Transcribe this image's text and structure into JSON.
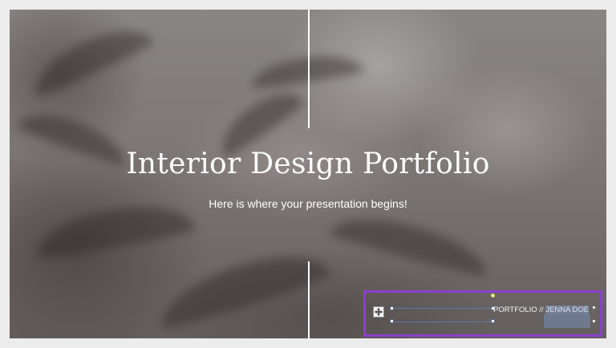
{
  "slide": {
    "title": "Interior Design Portfolio",
    "subtitle": "Here is where your presentation begins!"
  },
  "footer": {
    "label": "PORTFOLIO // ",
    "name": "JENNA DOE"
  },
  "colors": {
    "selection_outline": "#8b3fd1",
    "title_text": "#ffffff",
    "background": "#6f6a69"
  },
  "icons": {
    "move": "move-icon"
  }
}
